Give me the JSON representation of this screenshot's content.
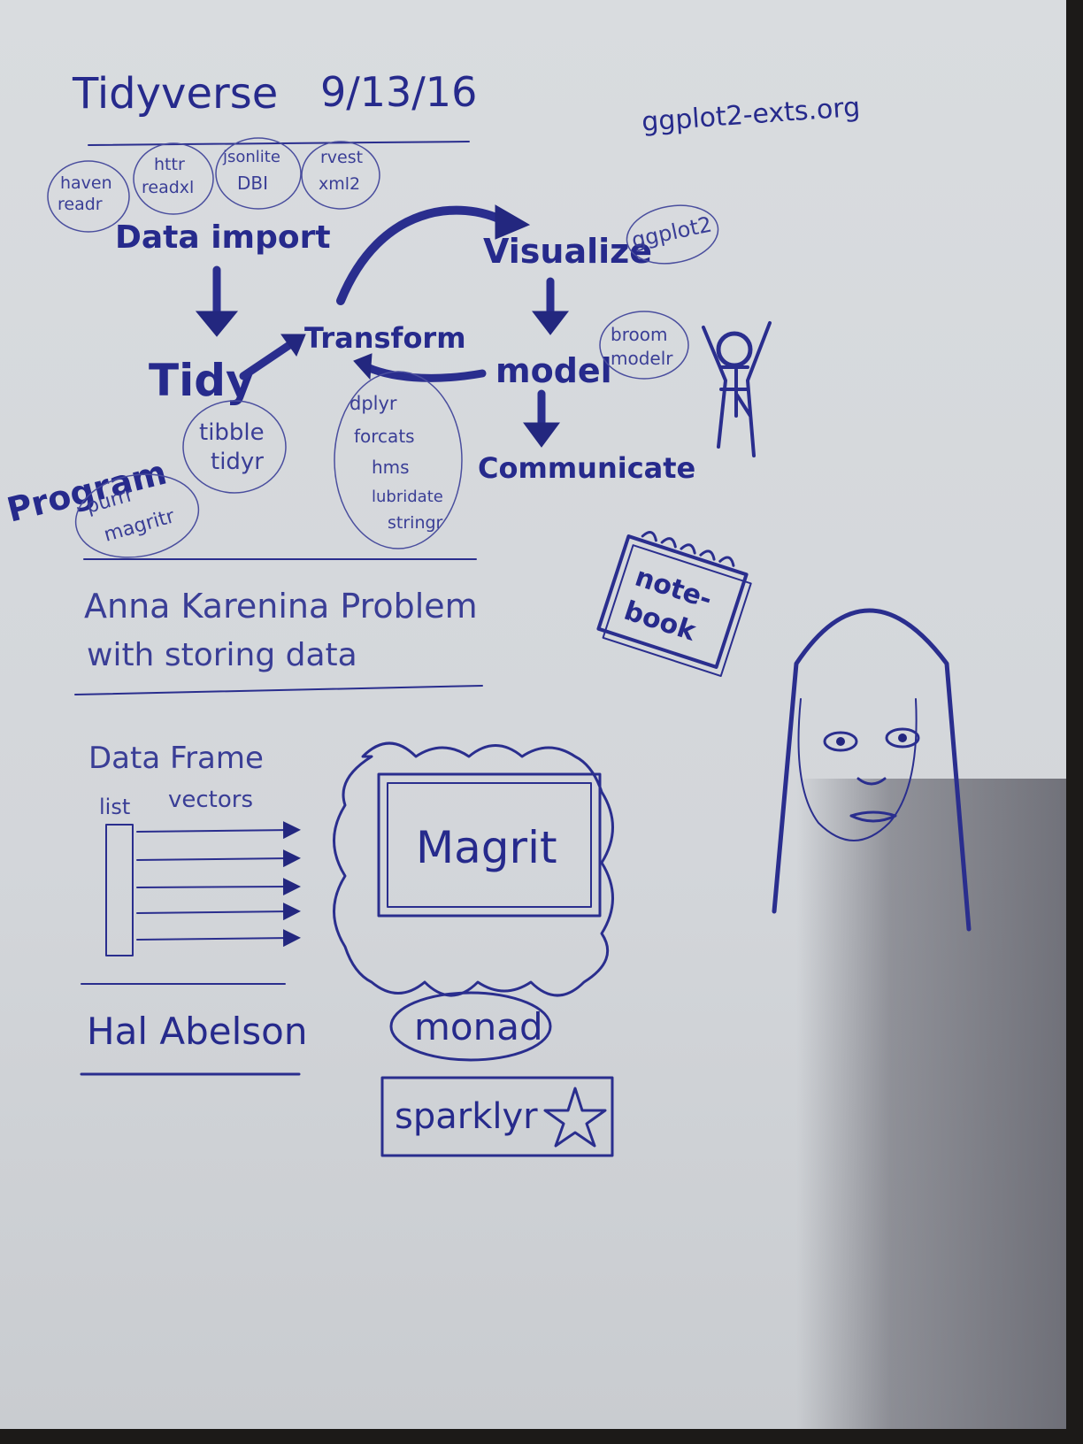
{
  "title": "Tidyverse",
  "date": "9/13/16",
  "url": "ggplot2-exts.org",
  "import_packages": [
    {
      "line1": "haven",
      "line2": "readr"
    },
    {
      "line1": "httr",
      "line2": "readxl"
    },
    {
      "line1": "jsonlite",
      "line2": "DBI"
    },
    {
      "line1": "rvest",
      "line2": "xml2"
    }
  ],
  "workflow": {
    "import": "Data import",
    "tidy": "Tidy",
    "transform": "Transform",
    "visualize": "Visualize",
    "model": "model",
    "communicate": "Communicate",
    "program": "Program"
  },
  "package_groups": {
    "visualize": "ggplot2",
    "model": {
      "line1": "broom",
      "line2": "modelr"
    },
    "tidy": {
      "line1": "tibble",
      "line2": "tidyr"
    },
    "program": {
      "line1": "purrr",
      "line2": "magritr"
    },
    "transform": [
      "dplyr",
      "forcats",
      "hms",
      "lubridate",
      "stringr"
    ]
  },
  "notebook": {
    "line1": "note-",
    "line2": "book"
  },
  "anna": {
    "line1": "Anna Karenina Problem",
    "line2": "with storing data"
  },
  "dataframe": {
    "title": "Data Frame",
    "list_label": "list",
    "vectors_label": "vectors"
  },
  "frame_label": "Magrit",
  "person": "Hal Abelson",
  "monad": "monad",
  "sparklyr": "sparklyr",
  "colors": {
    "ink": "#262a8c",
    "paper": "#d6d9dd"
  }
}
